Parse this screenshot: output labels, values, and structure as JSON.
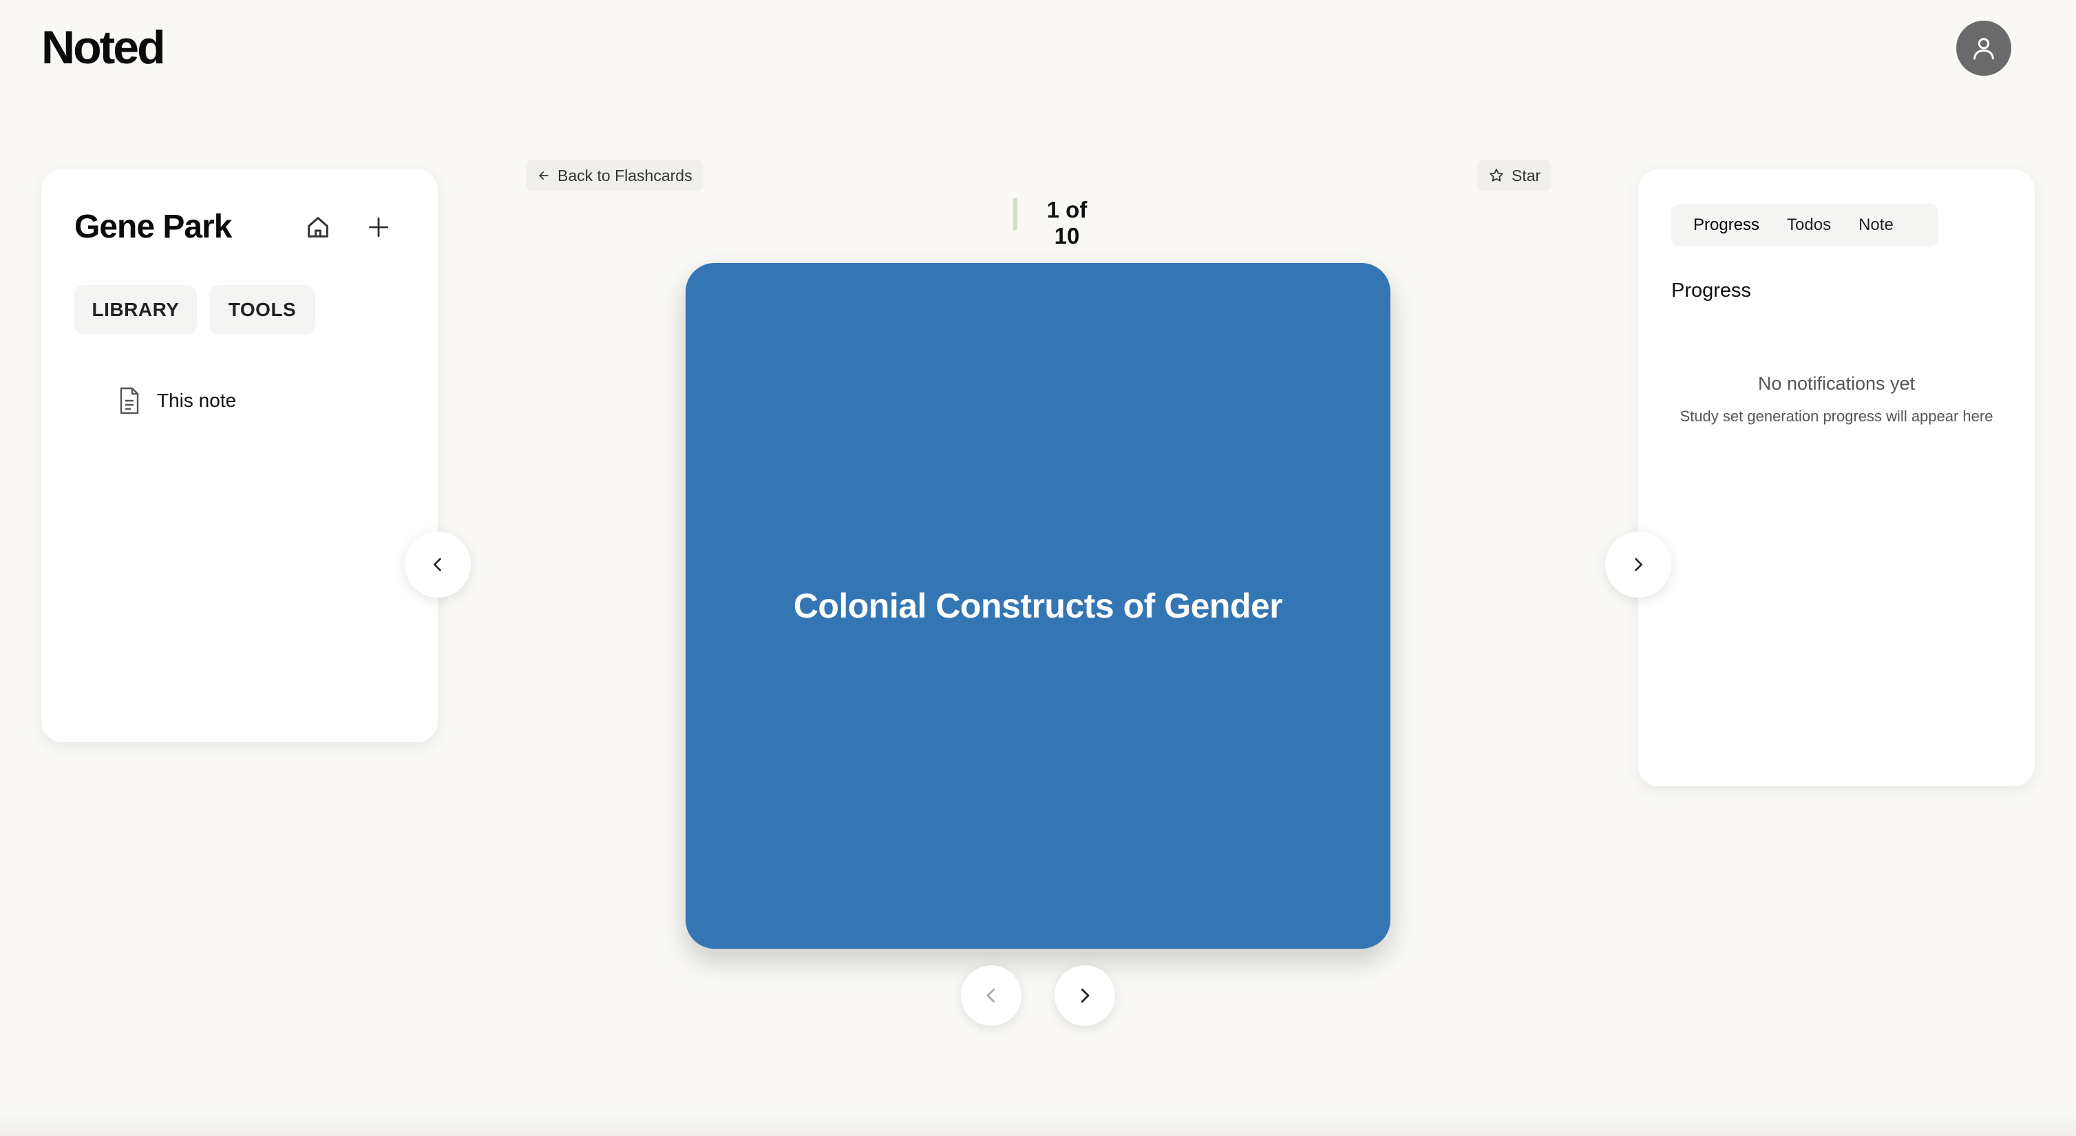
{
  "app": {
    "logo": "Noted"
  },
  "header": {
    "avatar_icon": "user-icon"
  },
  "sidebar": {
    "title": "Gene Park",
    "home_icon": "home-icon",
    "add_icon": "plus-icon",
    "pills": [
      "LIBRARY",
      "TOOLS"
    ],
    "items": [
      {
        "icon": "document-icon",
        "label": "This note"
      }
    ]
  },
  "flashcards": {
    "back_label": "Back to Flashcards",
    "star_label": "Star",
    "counter": "1 of 10",
    "card_text": "Colonial Constructs of Gender",
    "card_color": "#3476b3"
  },
  "right_panel": {
    "tabs": [
      "Progress",
      "Todos",
      "Note"
    ],
    "active_tab": "Progress",
    "section_title": "Progress",
    "empty_title": "No notifications yet",
    "empty_subtitle": "Study set generation progress will appear here"
  }
}
